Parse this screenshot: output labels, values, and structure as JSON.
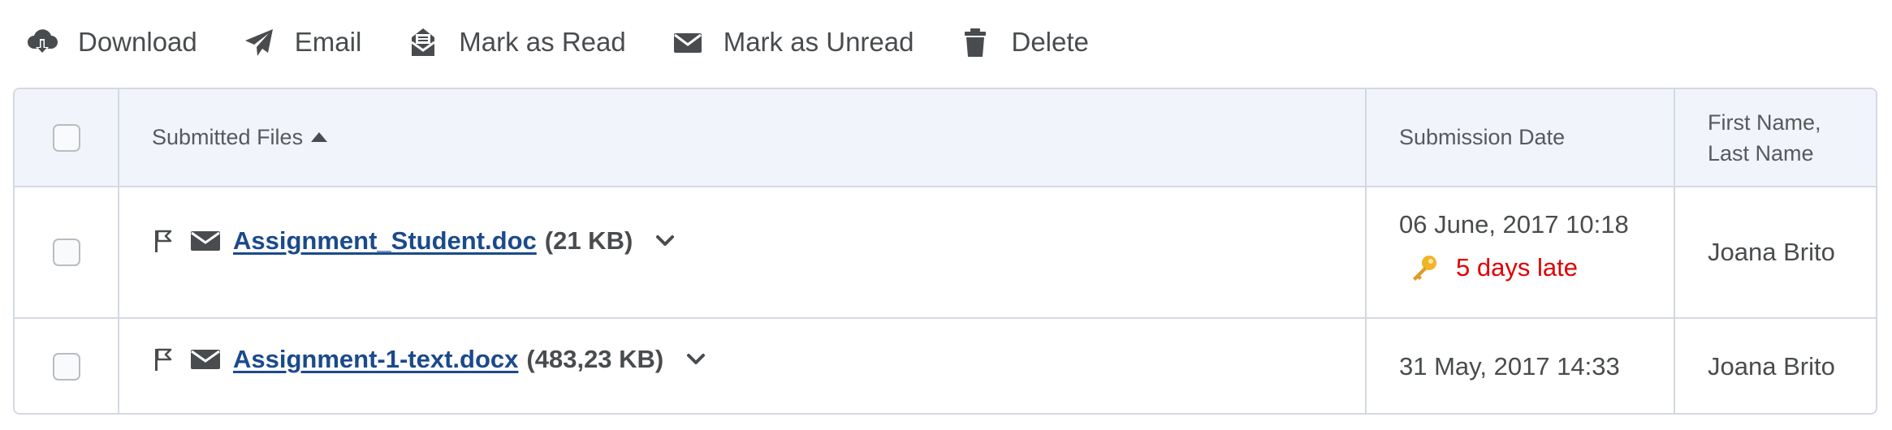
{
  "toolbar": {
    "download": {
      "label": "Download",
      "icon": "cloud-download-icon"
    },
    "email": {
      "label": "Email",
      "icon": "paper-plane-icon"
    },
    "mark_read": {
      "label": "Mark as Read",
      "icon": "envelope-open-icon"
    },
    "mark_unread": {
      "label": "Mark as Unread",
      "icon": "envelope-icon"
    },
    "delete": {
      "label": "Delete",
      "icon": "trash-icon"
    }
  },
  "table": {
    "headers": {
      "files": "Submitted Files",
      "date": "Submission Date",
      "name_line1": "First Name,",
      "name_line2": "Last Name"
    },
    "rows": [
      {
        "file_name": "Assignment_Student.doc",
        "file_size": "(21 KB)",
        "date": "06 June, 2017 10:18",
        "late": "5 days late",
        "name": "Joana Brito"
      },
      {
        "file_name": "Assignment-1-text.docx",
        "file_size": "(483,23 KB)",
        "date": "31 May, 2017 14:33",
        "name": "Joana Brito"
      }
    ]
  },
  "colors": {
    "link": "#1b4a8c",
    "late": "#e00000",
    "header_bg": "#f1f5fb",
    "border": "#d3d9e3",
    "text": "#494c4e"
  }
}
